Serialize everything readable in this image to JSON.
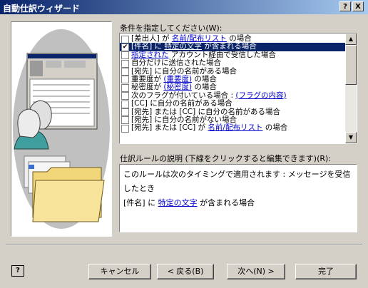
{
  "window": {
    "title": "自動仕訳ウィザード",
    "help_btn": "?",
    "close_btn": "X"
  },
  "conditions": {
    "label": "条件を指定してください(W):",
    "items": [
      {
        "checked": false,
        "parts": [
          {
            "text": "[差出人] が "
          },
          {
            "text": "名前/配布リスト",
            "link": true
          },
          {
            "text": " の場合"
          }
        ]
      },
      {
        "checked": true,
        "selected": true,
        "parts": [
          {
            "text": "[件名] に "
          },
          {
            "text": "特定の文字",
            "link": true
          },
          {
            "text": " が含まれる場合"
          }
        ]
      },
      {
        "checked": false,
        "parts": [
          {
            "text": "指定された",
            "link": true
          },
          {
            "text": " アカウント経由で受信した場合"
          }
        ]
      },
      {
        "checked": false,
        "parts": [
          {
            "text": "自分だけに送信された場合"
          }
        ]
      },
      {
        "checked": false,
        "parts": [
          {
            "text": "[宛先] に自分の名前がある場合"
          }
        ]
      },
      {
        "checked": false,
        "parts": [
          {
            "text": "重要度が "
          },
          {
            "text": "(重要度)",
            "link": true
          },
          {
            "text": " の場合"
          }
        ]
      },
      {
        "checked": false,
        "parts": [
          {
            "text": "秘密度が "
          },
          {
            "text": "(秘密度)",
            "link": true
          },
          {
            "text": " の場合"
          }
        ]
      },
      {
        "checked": false,
        "parts": [
          {
            "text": "次のフラグが付いている場合 : "
          },
          {
            "text": "(フラグの内容)",
            "link": true
          }
        ]
      },
      {
        "checked": false,
        "parts": [
          {
            "text": "[CC] に自分の名前がある場合"
          }
        ]
      },
      {
        "checked": false,
        "parts": [
          {
            "text": "[宛先] または [CC] に自分の名前がある場合"
          }
        ]
      },
      {
        "checked": false,
        "parts": [
          {
            "text": "[宛先] に自分の名前がない場合"
          }
        ]
      },
      {
        "checked": false,
        "parts": [
          {
            "text": "[宛先] または [CC] が "
          },
          {
            "text": "名前/配布リスト",
            "link": true
          },
          {
            "text": " の場合"
          }
        ]
      }
    ]
  },
  "description": {
    "label": "仕訳ルールの説明 (下線をクリックすると編集できます)(R):",
    "line1": "このルールは次のタイミングで適用されます : メッセージを受信したとき",
    "line2_prefix": "[件名] に ",
    "line2_link": "特定の文字",
    "line2_suffix": " が含まれる場合"
  },
  "buttons": {
    "cancel": "キャンセル",
    "back": "< 戻る(B)",
    "next": "次へ(N) >",
    "finish": "完了"
  },
  "help_icon": "?"
}
